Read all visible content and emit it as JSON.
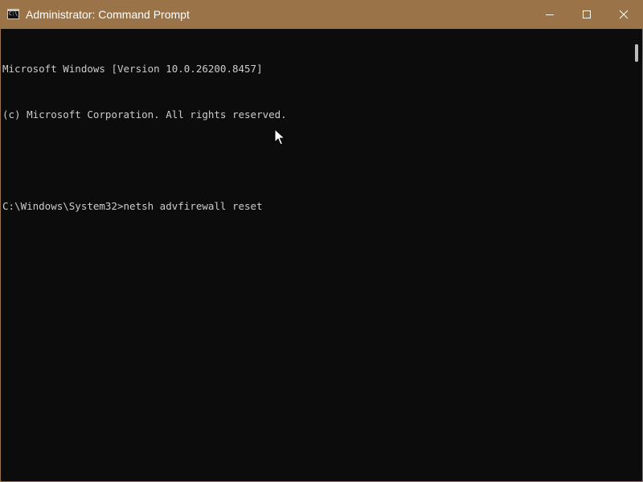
{
  "window": {
    "title": "Administrator: Command Prompt",
    "app_icon_text": "C:\\_",
    "titlebar_color": "#9a7448",
    "background_color": "#0c0c0c",
    "text_color": "#cccccc"
  },
  "window_controls": {
    "minimize": "minimize-icon",
    "maximize": "maximize-icon",
    "close": "close-icon"
  },
  "console": {
    "lines": [
      "Microsoft Windows [Version 10.0.26200.8457]",
      "(c) Microsoft Corporation. All rights reserved.",
      "",
      "C:\\Windows\\System32>netsh advfirewall reset"
    ]
  },
  "scrollbar": {
    "thumb_color": "#bdbdbd"
  },
  "pointer": {
    "icon": "mouse-pointer-icon"
  }
}
